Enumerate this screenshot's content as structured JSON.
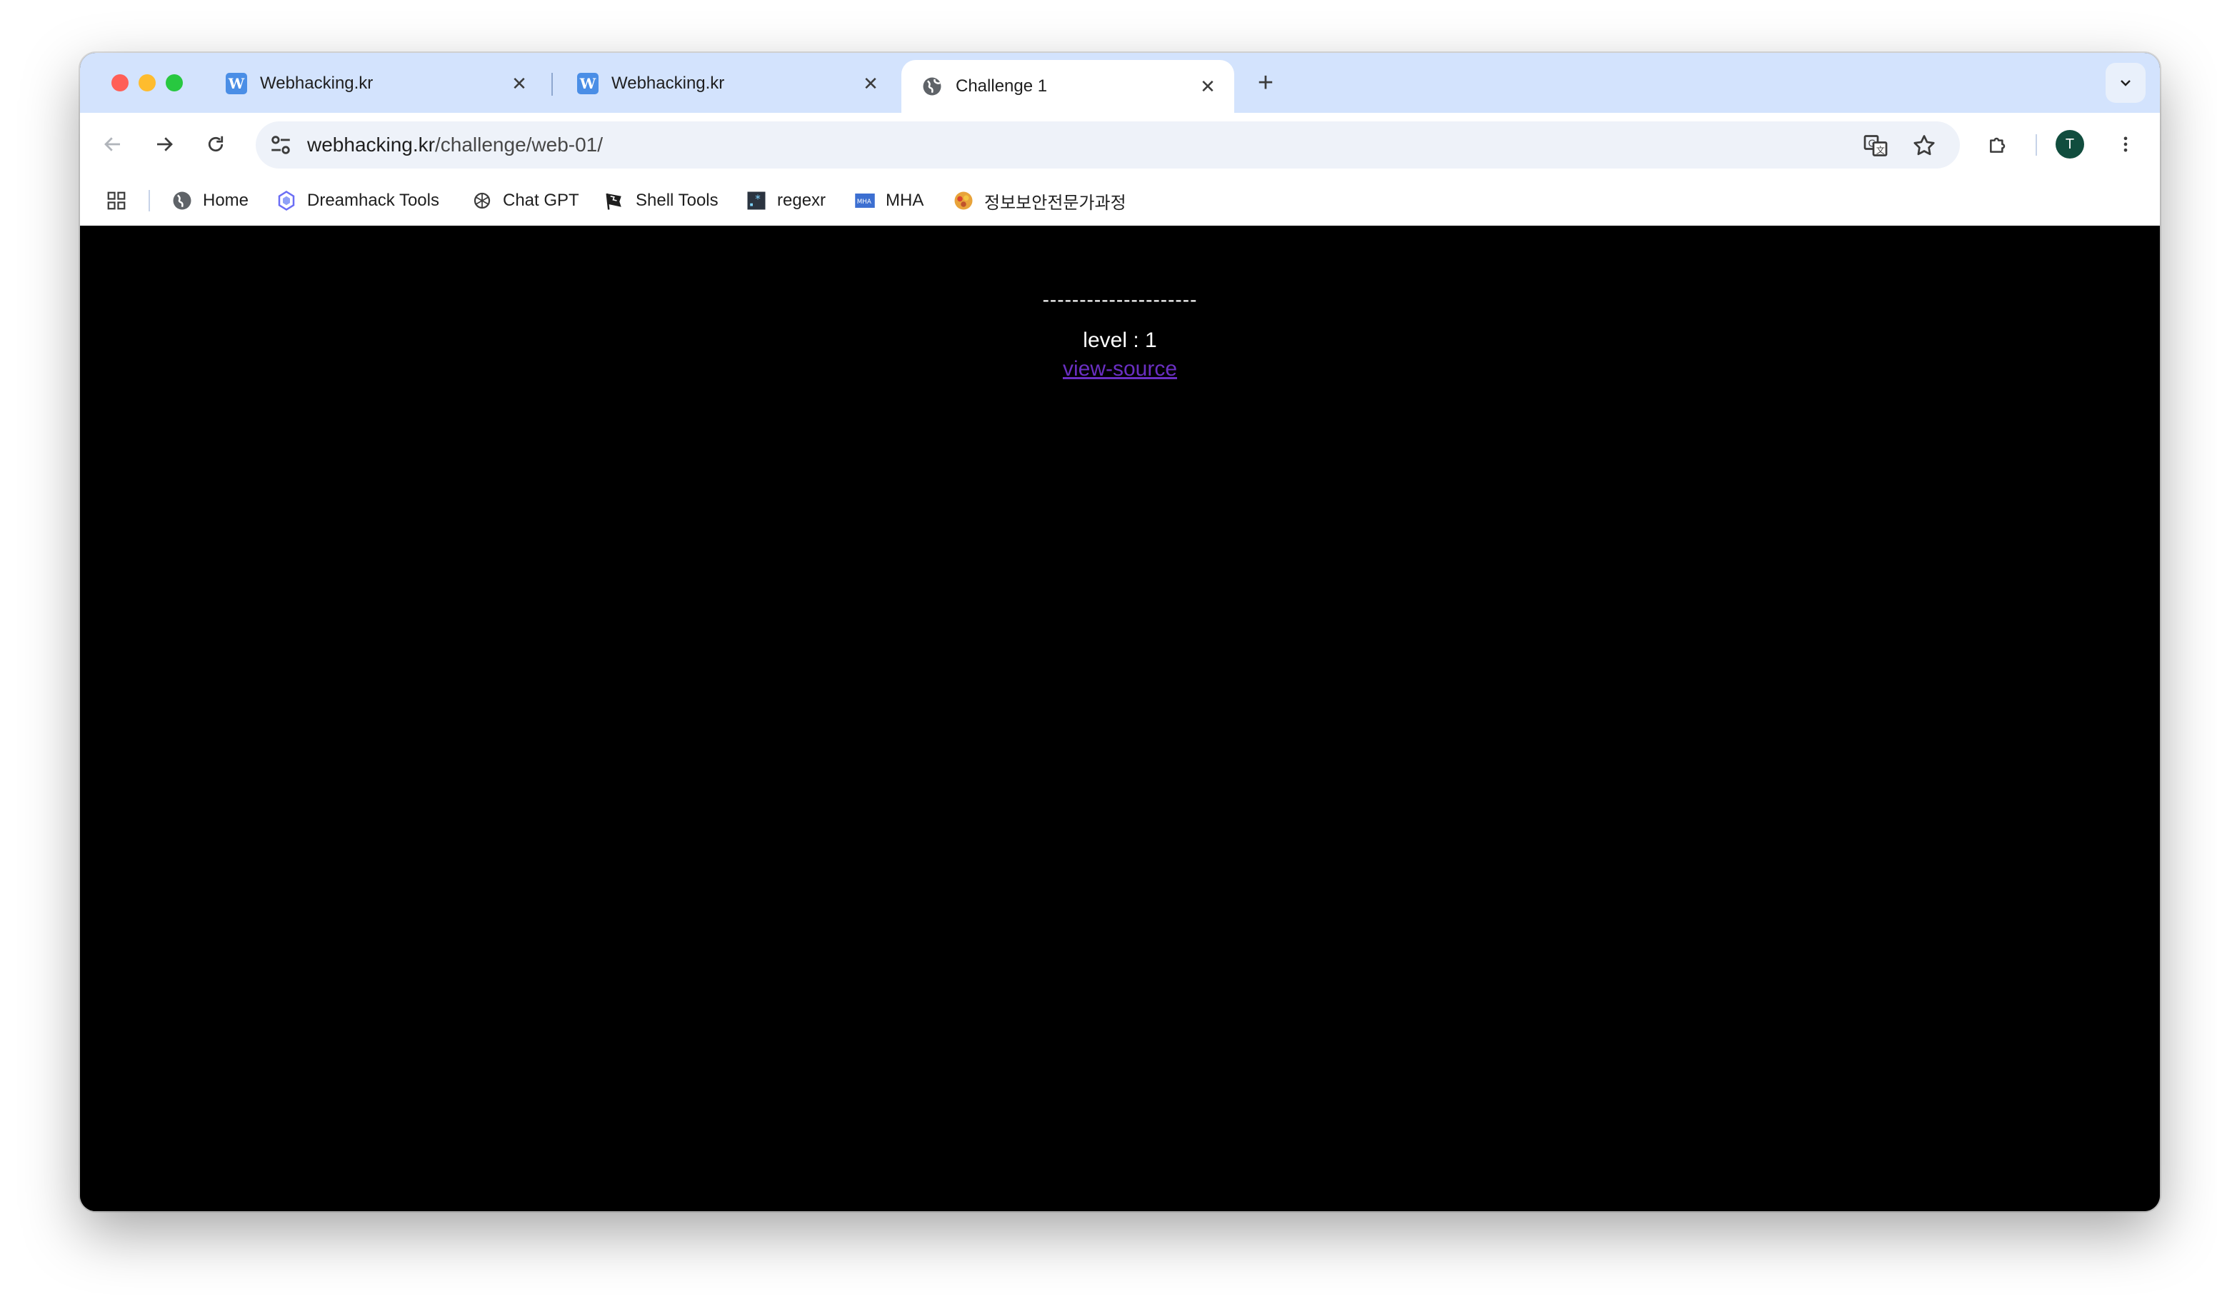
{
  "tabs": [
    {
      "title": "Webhacking.kr",
      "favicon": "W",
      "active": false
    },
    {
      "title": "Webhacking.kr",
      "favicon": "W",
      "active": false
    },
    {
      "title": "Challenge 1",
      "favicon": "globe-icon",
      "active": true
    }
  ],
  "address_bar": {
    "host": "webhacking.kr",
    "path": "/challenge/web-01/"
  },
  "profile": {
    "initial": "T",
    "color": "#114d3e"
  },
  "bookmarks": [
    {
      "label": "Home",
      "icon": "globe-icon"
    },
    {
      "label": "Dreamhack Tools",
      "icon": "dreamhack-icon"
    },
    {
      "label": "Chat GPT",
      "icon": "openai-icon"
    },
    {
      "label": "Shell Tools",
      "icon": "flag-icon"
    },
    {
      "label": "regexr",
      "icon": "regexr-icon"
    },
    {
      "label": "MHA",
      "icon": "mha-icon",
      "icon_text": "MHA"
    },
    {
      "label": "정보보안전문가과정",
      "icon": "badge-icon"
    }
  ],
  "page": {
    "dashes": "---------------------",
    "level_text": "level : 1",
    "link_text": "view-source",
    "background": "#000000",
    "text_color": "#ffffff",
    "link_color": "#6a2fc2"
  },
  "colors": {
    "tab_strip": "#d3e3fd",
    "omnibox": "#eef2f9"
  }
}
